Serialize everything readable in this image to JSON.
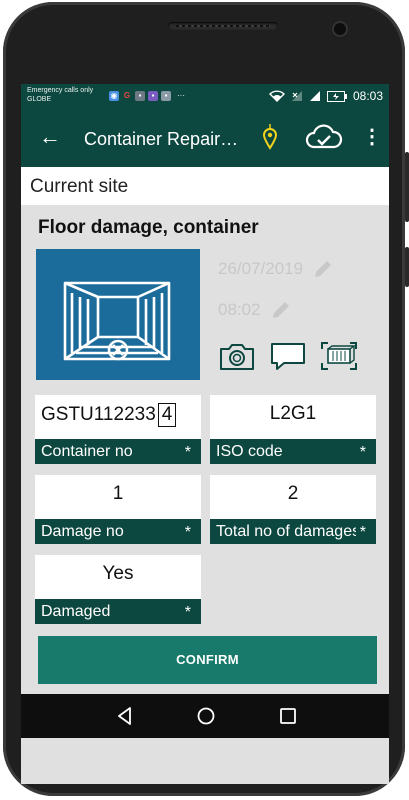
{
  "statusbar": {
    "carrier_line1": "Emergency calls only",
    "carrier_line2": "GLOBE",
    "time": "08:03",
    "more": "···"
  },
  "toolbar": {
    "back": "←",
    "title": "Container Repair…",
    "menu": "⋮"
  },
  "site": {
    "label": "Current site"
  },
  "damage": {
    "title": "Floor damage, container",
    "date": "26/07/2019",
    "time": "08:02"
  },
  "fields": {
    "container_no": {
      "value": "GSTU112233",
      "check_digit": "4",
      "label": "Container no",
      "required": "*"
    },
    "iso_code": {
      "value": "L2G1",
      "label": "ISO code",
      "required": "*"
    },
    "damage_no": {
      "value": "1",
      "label": "Damage no",
      "required": "*"
    },
    "total_damages": {
      "value": "2",
      "label": "Total no of damages",
      "required": "*"
    },
    "damaged": {
      "value": "Yes",
      "label": "Damaged",
      "required": "*"
    }
  },
  "confirm_label": "CONFIRM",
  "colors": {
    "primary": "#0d4840",
    "button": "#177a6a",
    "thumbnail": "#1b6b9b",
    "location_pin": "#f2d21b"
  }
}
